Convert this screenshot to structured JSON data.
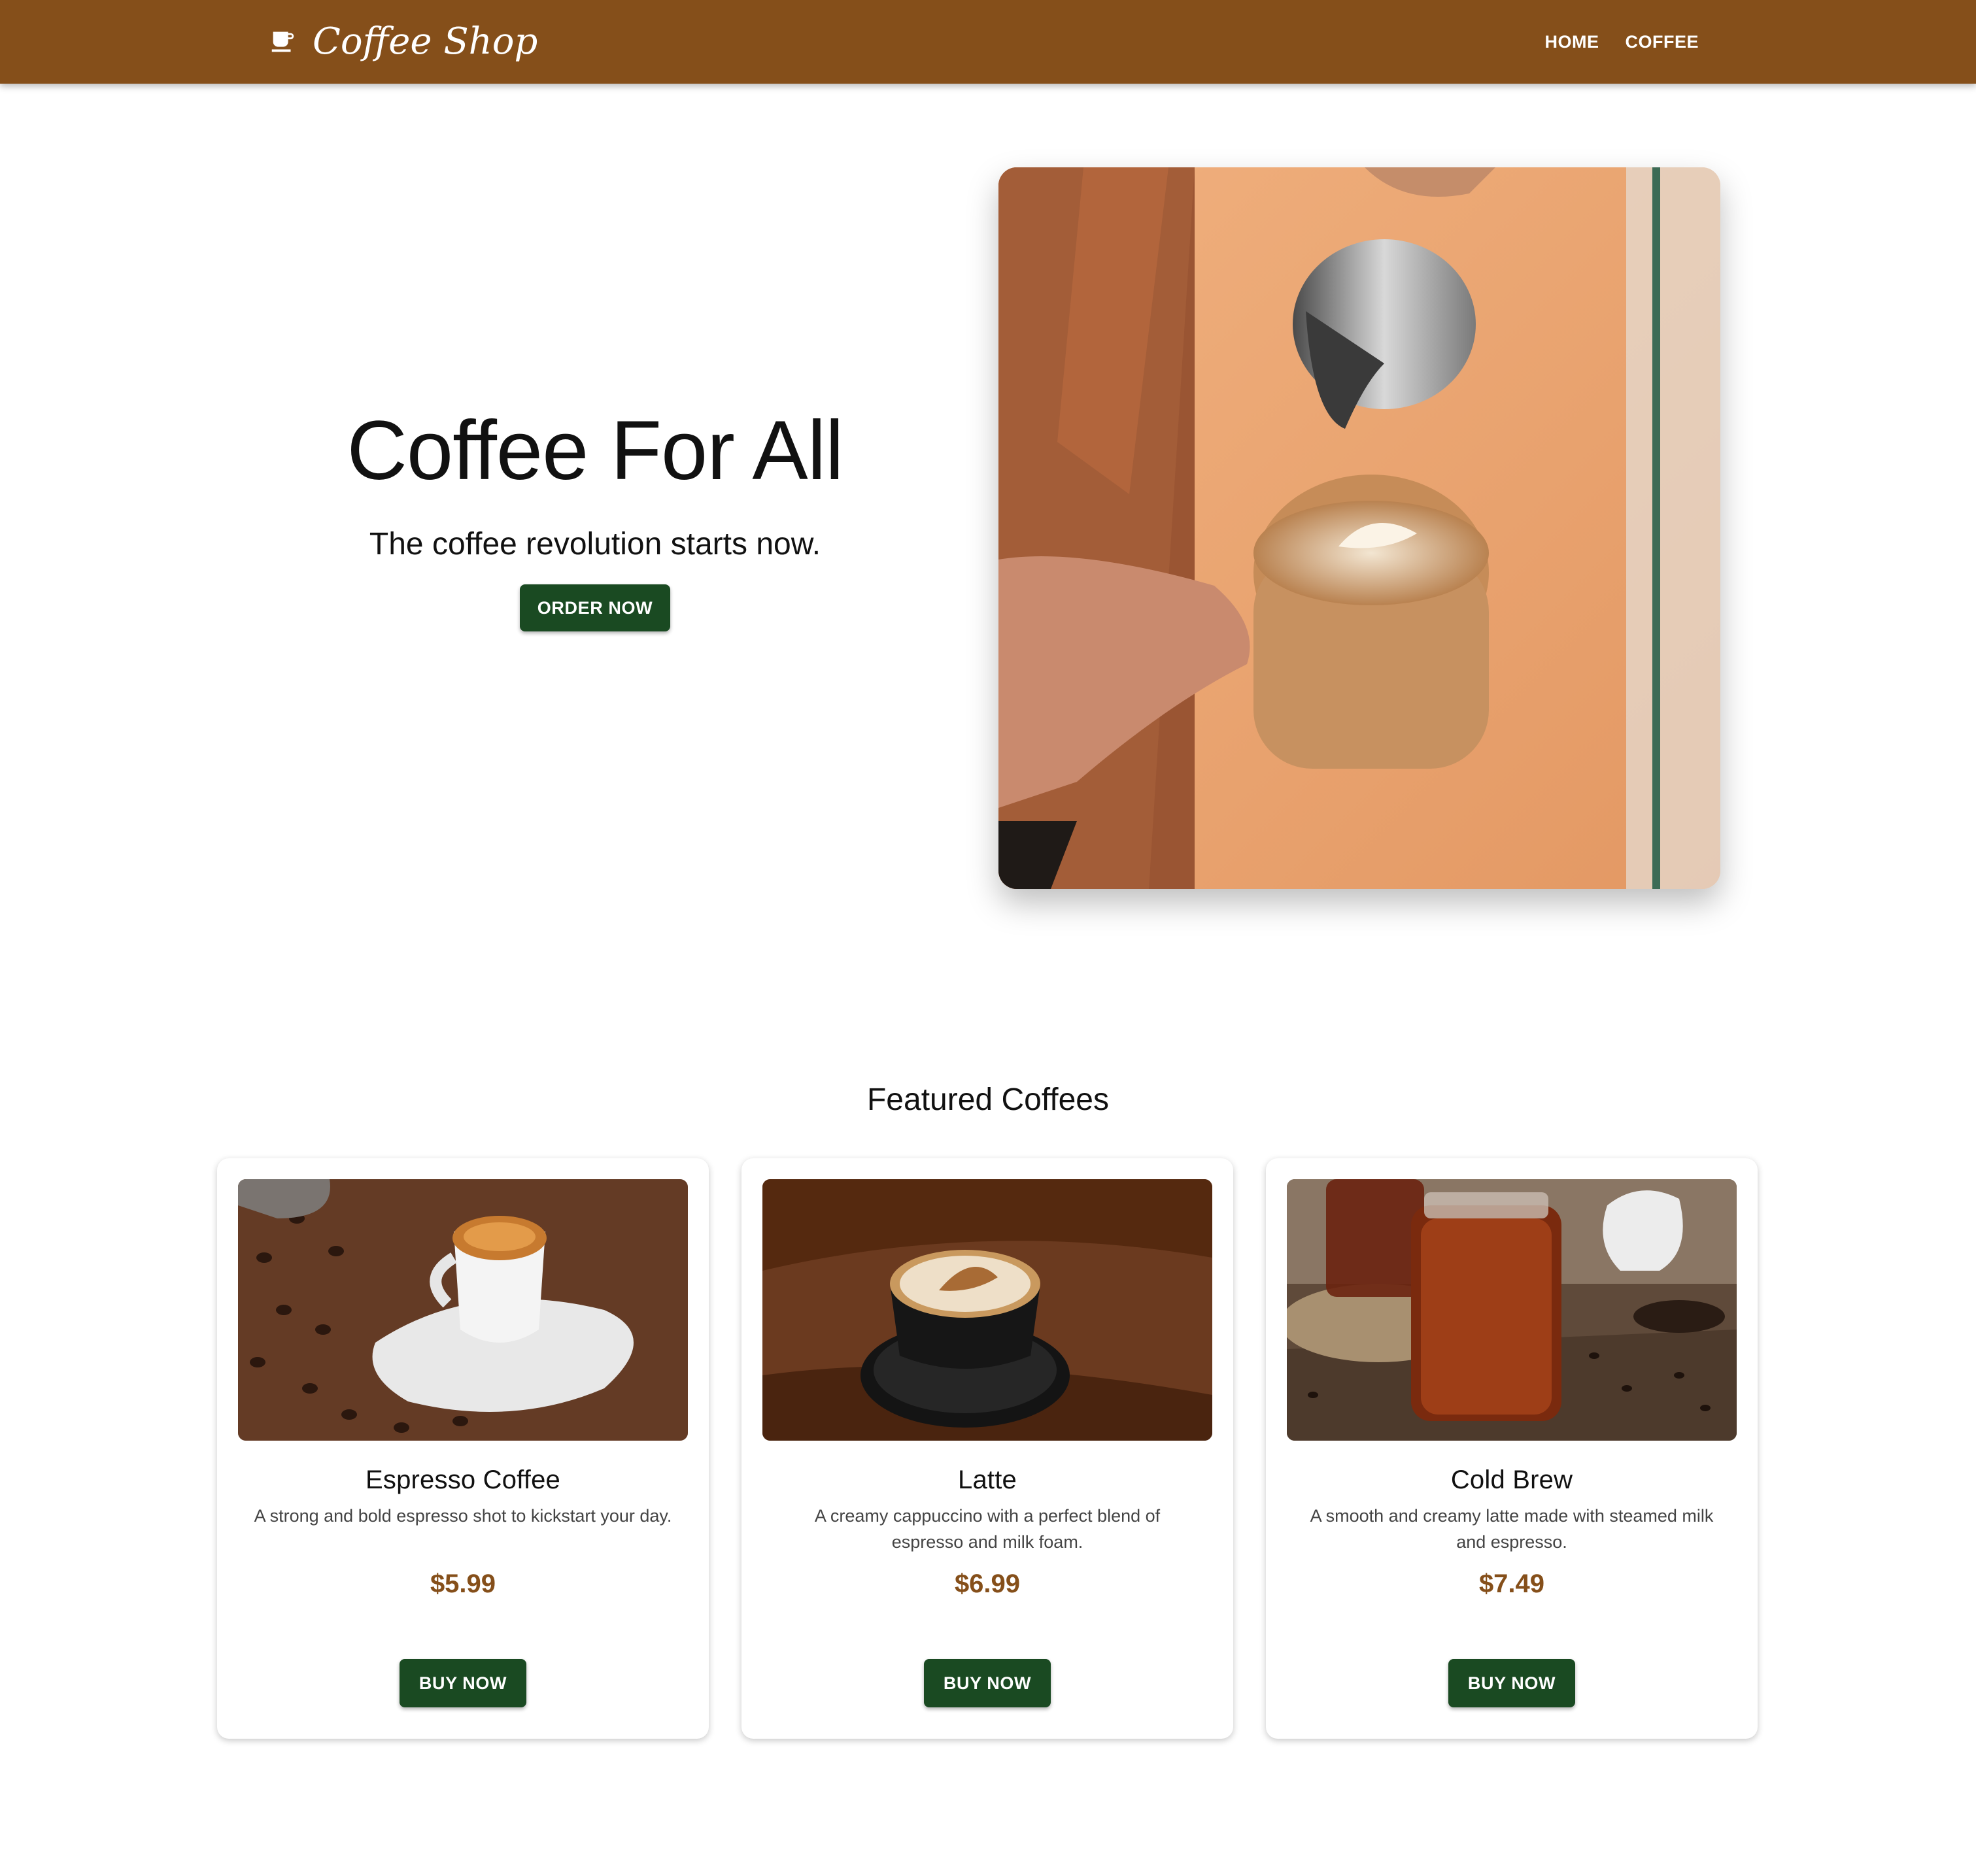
{
  "header": {
    "brand": "Coffee Shop",
    "brand_icon": "coffee-cup-icon",
    "nav": [
      {
        "label": "HOME"
      },
      {
        "label": "COFFEE"
      }
    ]
  },
  "hero": {
    "title": "Coffee For All",
    "subtitle": "The coffee revolution starts now.",
    "cta": "ORDER NOW",
    "image": "latte-art-pouring-photo"
  },
  "featured": {
    "title": "Featured Coffees",
    "cards": [
      {
        "name": "Espresso Coffee",
        "description": "A strong and bold espresso shot to kickstart your day.",
        "price": "$5.99",
        "button": "BUY NOW",
        "image": "espresso-cup-photo"
      },
      {
        "name": "Latte",
        "description": "A creamy cappuccino with a perfect blend of espresso and milk foam.",
        "price": "$6.99",
        "button": "BUY NOW",
        "image": "latte-cup-photo"
      },
      {
        "name": "Cold Brew",
        "description": "A smooth and creamy latte made with steamed milk and espresso.",
        "price": "$7.49",
        "button": "BUY NOW",
        "image": "cold-brew-jar-photo"
      }
    ]
  },
  "colors": {
    "header_bg": "#854f1a",
    "button_bg": "#1a4a22",
    "price": "#854f1a"
  }
}
